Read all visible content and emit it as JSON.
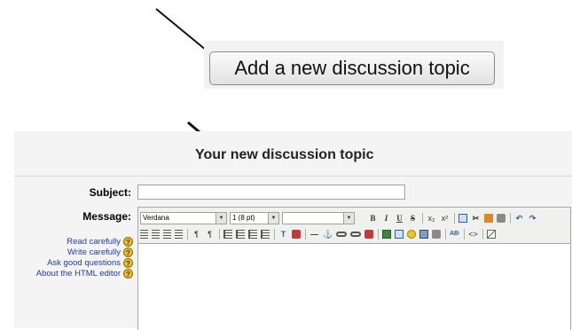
{
  "add_topic_button": {
    "label": "Add a new discussion topic"
  },
  "form": {
    "heading": "Your new discussion topic",
    "subject_label": "Subject:",
    "subject_value": "",
    "message_label": "Message:"
  },
  "editor": {
    "font_select": "Verdana",
    "size_select": "1 (8 pt)",
    "format_select": "",
    "dropdown_glyph": "▼"
  },
  "help_links": [
    {
      "label": "Read carefully",
      "icon": "help-icon"
    },
    {
      "label": "Write carefully",
      "icon": "help-icon"
    },
    {
      "label": "Ask good questions",
      "icon": "help-icon"
    },
    {
      "label": "About the HTML editor",
      "icon": "help-icon"
    }
  ],
  "colors": {
    "link": "#1c3ca8",
    "help_icon": "#f0c020"
  }
}
